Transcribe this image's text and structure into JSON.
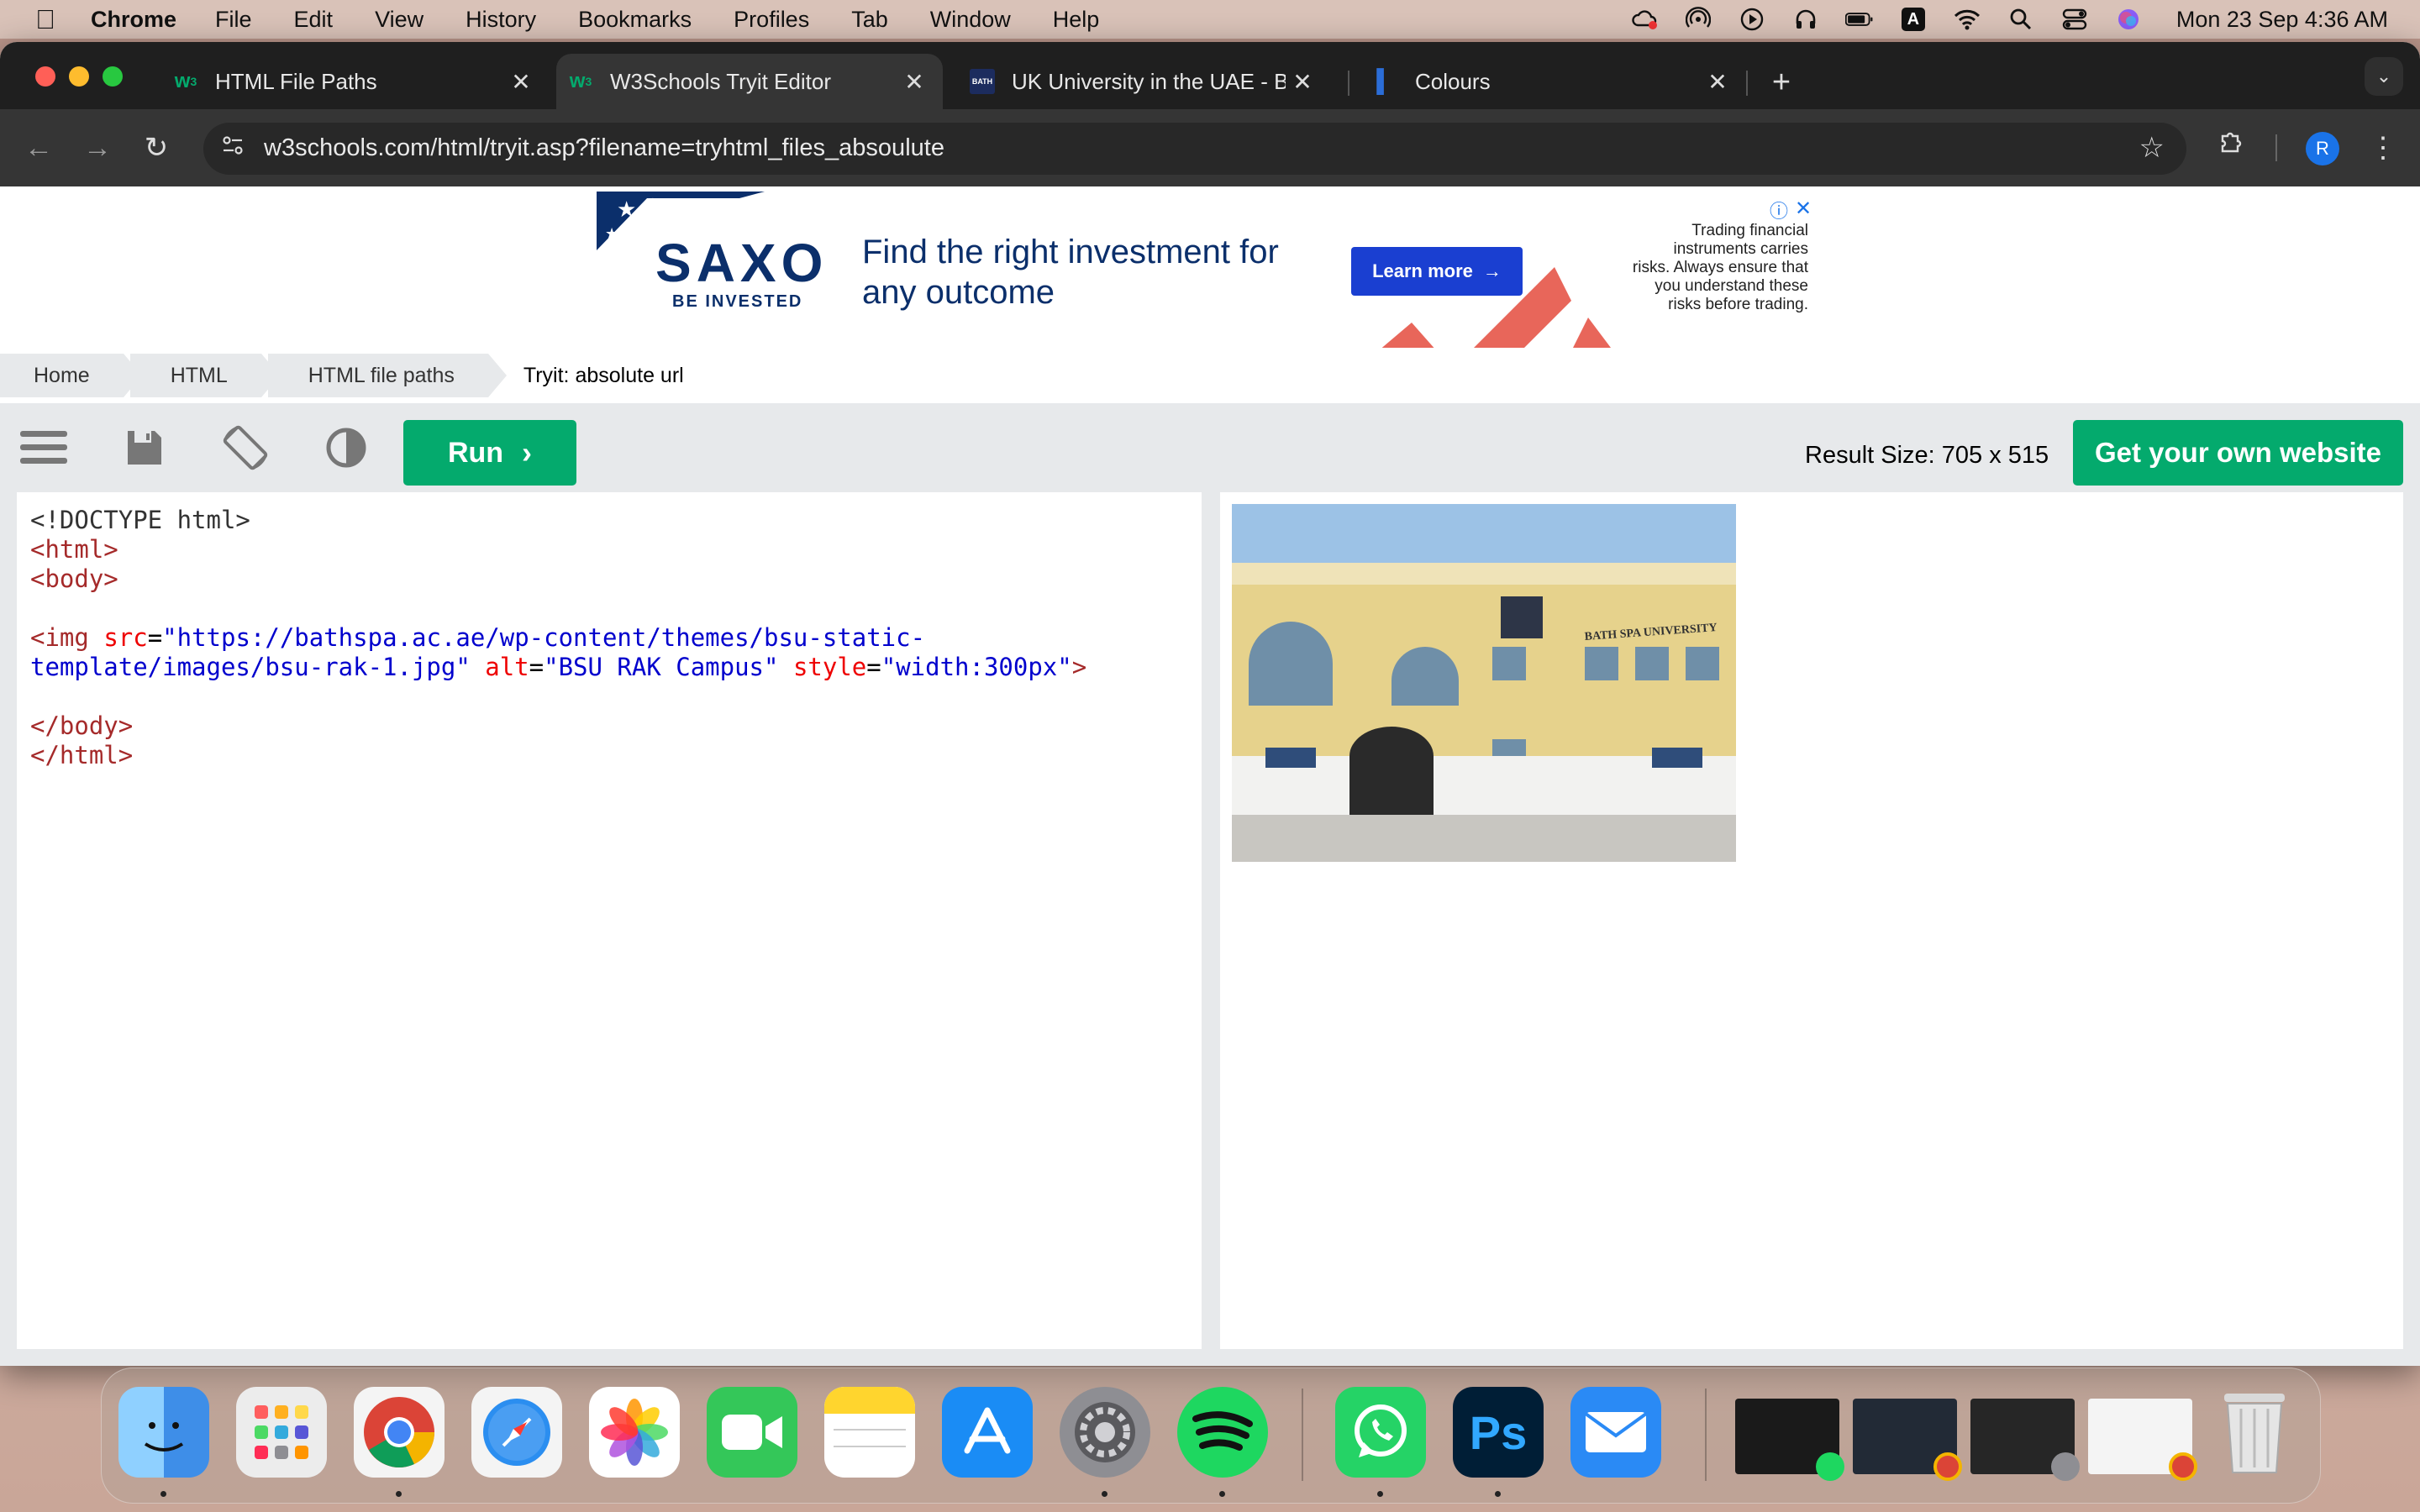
{
  "menubar": {
    "app_name": "Chrome",
    "menus": [
      "File",
      "Edit",
      "View",
      "History",
      "Bookmarks",
      "Profiles",
      "Tab",
      "Window",
      "Help"
    ],
    "clock": "Mon 23 Sep  4:36 AM",
    "status_icons": [
      "creative-cloud-icon",
      "airdrop-icon",
      "play-icon",
      "headphones-icon",
      "battery-icon",
      "keyboard-input-icon",
      "wifi-icon",
      "spotlight-search-icon",
      "control-center-icon",
      "siri-icon"
    ],
    "input_source": "A"
  },
  "tabs": [
    {
      "title": "HTML File Paths",
      "icon": "w3schools-favicon",
      "active": false
    },
    {
      "title": "W3Schools Tryit Editor",
      "icon": "w3schools-favicon",
      "active": true
    },
    {
      "title": "UK University in the UAE - Ba",
      "icon": "bath-spa-favicon",
      "active": false
    },
    {
      "title": "Colours",
      "icon": "blue-favicon",
      "active": false
    }
  ],
  "toolbar": {
    "url": "w3schools.com/html/tryit.asp?filename=tryhtml_files_absoulute",
    "avatar_letter": "R"
  },
  "ad": {
    "brand": "SAXO",
    "tagline": "BE INVESTED",
    "headline": "Find the right investment for any outcome",
    "button": "Learn more",
    "disclaimer": "Trading financial instruments carries risks. Always ensure that you understand these risks before trading."
  },
  "breadcrumb": [
    "Home",
    "HTML",
    "HTML file paths",
    "Tryit: absolute url"
  ],
  "tryit": {
    "run_label": "Run",
    "result_size": "Result Size: 705 x 515",
    "get_website": "Get your own website"
  },
  "code_lines": {
    "l1": "<!DOCTYPE html>",
    "l2_tag": "<html>",
    "l3_tag": "<body>",
    "l5_open": "<img",
    "l5_attr1": "src",
    "l5_val1a": "\"https://bathspa.ac.ae/wp-content/themes/bsu-static-",
    "l6_val1b": "template/images/bsu-rak-1.jpg\"",
    "l6_attr2": "alt",
    "l6_val2": "\"BSU RAK Campus\"",
    "l6_attr3": "style",
    "l6_val3": "\"width:300px\"",
    "l6_close": ">",
    "l8_tag": "</body>",
    "l9_tag": "</html>"
  },
  "result": {
    "image_sign": "BATH SPA UNIVERSITY"
  },
  "dock": {
    "apps": [
      "Finder",
      "Launchpad",
      "Google Chrome",
      "Safari",
      "Photos",
      "FaceTime",
      "Notes",
      "App Store",
      "System Settings",
      "Spotify",
      "WhatsApp",
      "Photoshop",
      "Mail"
    ],
    "ps_label": "Ps"
  }
}
